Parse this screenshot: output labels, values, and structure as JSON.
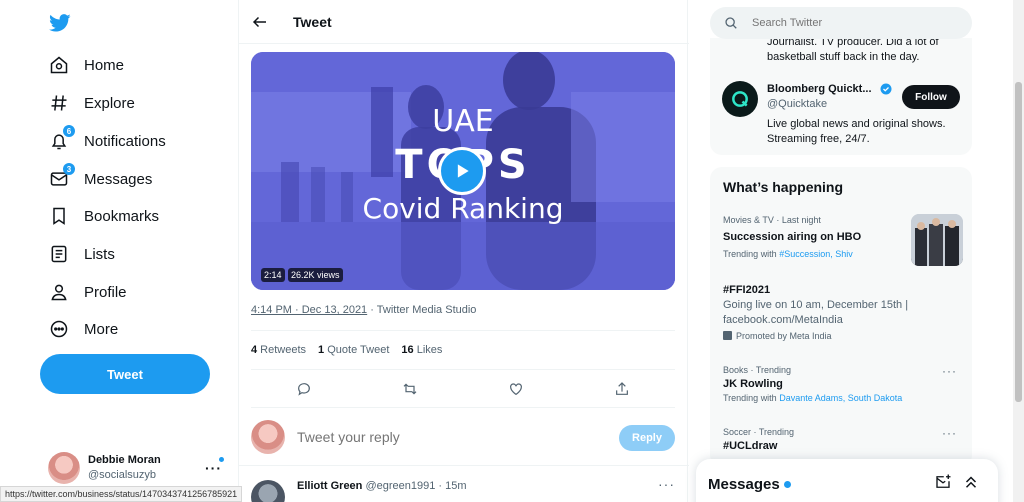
{
  "nav": {
    "items": [
      {
        "label": "Home",
        "icon": "home-icon"
      },
      {
        "label": "Explore",
        "icon": "hashtag-icon"
      },
      {
        "label": "Notifications",
        "icon": "bell-icon",
        "badge": "6"
      },
      {
        "label": "Messages",
        "icon": "envelope-icon",
        "badge": "3"
      },
      {
        "label": "Bookmarks",
        "icon": "bookmark-icon"
      },
      {
        "label": "Lists",
        "icon": "list-icon"
      },
      {
        "label": "Profile",
        "icon": "person-icon"
      },
      {
        "label": "More",
        "icon": "more-circle-icon"
      }
    ],
    "tweet_button": "Tweet"
  },
  "account": {
    "name": "Debbie Moran",
    "handle": "@socialsuzyb"
  },
  "main": {
    "title": "Tweet",
    "video": {
      "overlay_line1": "UAE",
      "overlay_line2": "TOPS",
      "overlay_line3": "Covid Ranking",
      "duration": "2:14",
      "views": "26.2K views"
    },
    "timestamp": "4:14 PM · Dec 13, 2021",
    "source": " · Twitter Media Studio",
    "stats": {
      "retweets_count": "4",
      "retweets_label": " Retweets",
      "quotes_count": "1",
      "quotes_label": " Quote Tweet",
      "likes_count": "16",
      "likes_label": " Likes"
    },
    "reply_placeholder": "Tweet your reply",
    "reply_button": "Reply",
    "next_tweet": {
      "name": "Elliott Green",
      "handle": "@egreen1991 · 15m"
    }
  },
  "right": {
    "search_placeholder": "Search Twitter",
    "who_prev_bio": "Journalist. TV producer. Did a lot of basketball stuff back in the day.",
    "who": {
      "name": "Bloomberg Quickt...",
      "handle": "@Quicktake",
      "follow_label": "Follow",
      "bio": "Live global news and original shows. Streaming free, 24/7."
    },
    "happening_title": "What’s happening",
    "trends": [
      {
        "meta": "Movies & TV · Last night",
        "name": "Succession airing on HBO",
        "sub_prefix": "Trending with ",
        "links": "#Succession, Shiv"
      },
      {
        "name": "#FFI2021",
        "body": "Going live on 10 am, December 15th | facebook.com/MetaIndia",
        "promo": "Promoted by Meta India"
      },
      {
        "meta": "Books · Trending",
        "name": "JK Rowling",
        "sub_prefix": "Trending with ",
        "links": "Davante Adams, South Dakota"
      },
      {
        "meta": "Soccer · Trending",
        "name": "#UCLdraw"
      }
    ],
    "messages_drawer_title": "Messages"
  },
  "status_url": "https://twitter.com/business/status/1470343741256785921",
  "colors": {
    "accent": "#1d9bf0",
    "text": "#0f1419",
    "muted": "#536471"
  }
}
